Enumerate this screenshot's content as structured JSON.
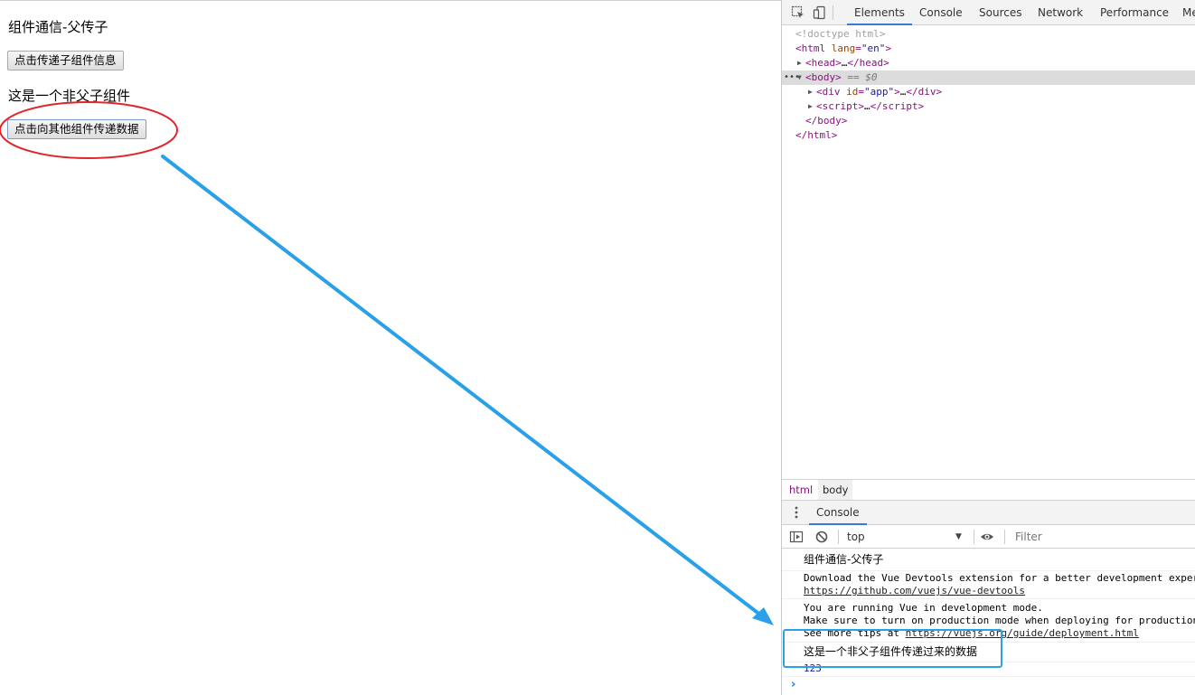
{
  "page": {
    "title": "组件通信-父传子",
    "button_child": "点击传递子组件信息",
    "subtitle": "这是一个非父子组件",
    "button_other": "点击向其他组件传递数据"
  },
  "devtools": {
    "tabs": [
      "Elements",
      "Console",
      "Sources",
      "Network",
      "Performance",
      "Me"
    ],
    "active_tab": "Elements",
    "tree": {
      "doctype": "<!doctype html>",
      "html_open_tag": "html",
      "html_attr_name": "lang",
      "html_attr_value": "\"en\"",
      "head_tag": "head",
      "body_tag": "body",
      "selected_marker": "== $0",
      "div_tag": "div",
      "div_attr_name": "id",
      "div_attr_value": "\"app\"",
      "script_tag": "script",
      "ellipsis": "…"
    },
    "breadcrumb": [
      "html",
      "body"
    ],
    "drawer_tab": "Console",
    "console_toolbar": {
      "context": "top",
      "filter_placeholder": "Filter"
    },
    "console_messages": {
      "m1": "组件通信-父传子",
      "m2_text": "Download the Vue Devtools extension for a better development exper",
      "m2_link": "https://github.com/vuejs/vue-devtools",
      "m3_line1": "You are running Vue in development mode.",
      "m3_line2": "Make sure to turn on production mode when deploying for production",
      "m3_line3_text": "See more tips at ",
      "m3_line3_link": "https://vuejs.org/guide/deployment.html",
      "m4": "这是一个非父子组件传递过来的数据",
      "m5": "123",
      "prompt": "›"
    }
  },
  "colors": {
    "ellipse_annotation": "#e0262b",
    "arrow_annotation": "#2aa0e8",
    "box_annotation": "#2aa0e8",
    "devtools_accent": "#3879d9"
  }
}
